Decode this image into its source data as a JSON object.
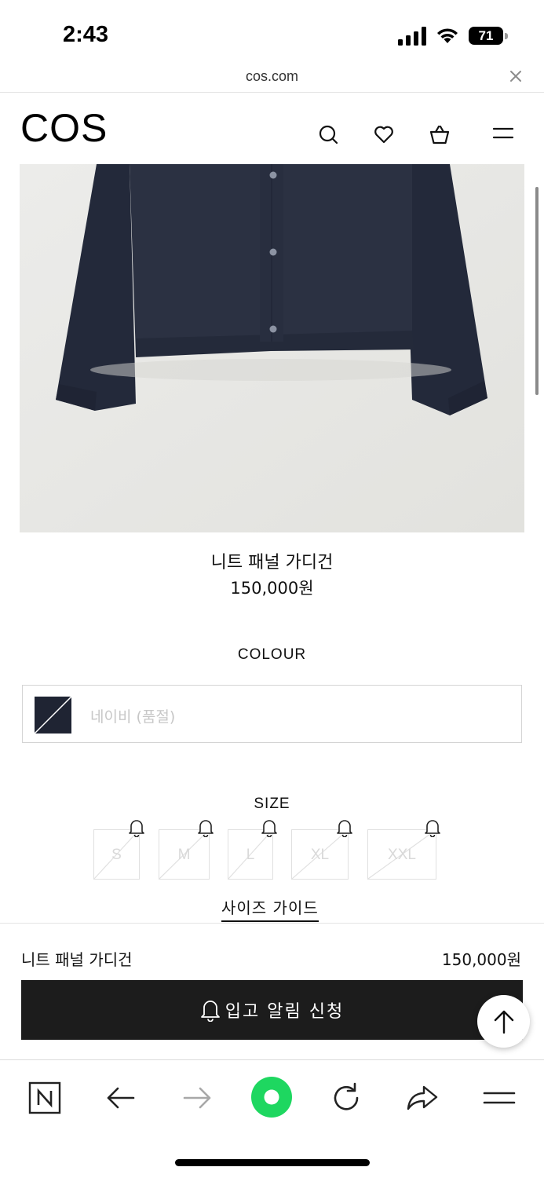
{
  "status_bar": {
    "time": "2:43",
    "battery": "71"
  },
  "url_bar": {
    "url": "cos.com",
    "close_icon": "close-icon"
  },
  "header": {
    "logo": "COS",
    "icons": [
      "search-icon",
      "heart-icon",
      "bag-icon",
      "menu-icon"
    ]
  },
  "product": {
    "name": "니트 패널 가디건",
    "price": "150,000원",
    "image_subject": "navy knit cardigan",
    "colour_label": "COLOUR",
    "colour_value": "네이비 (품절)",
    "swatch_color": "#1f2433",
    "size_label": "SIZE",
    "sizes": [
      "S",
      "M",
      "L",
      "XL",
      "XXL"
    ],
    "size_guide": "사이즈 가이드"
  },
  "sticky_bar": {
    "name": "니트 패널 가디건",
    "price": "150,000원",
    "notify_button": "입고 알림 신청",
    "button_color": "#1c1c1c"
  },
  "browser_toolbar": {
    "icons": [
      "naver-n-icon",
      "back-arrow-icon",
      "forward-arrow-icon",
      "green-home-icon",
      "reload-icon",
      "share-icon",
      "hamburger-menu-icon"
    ],
    "accent_color": "#1ed760"
  }
}
